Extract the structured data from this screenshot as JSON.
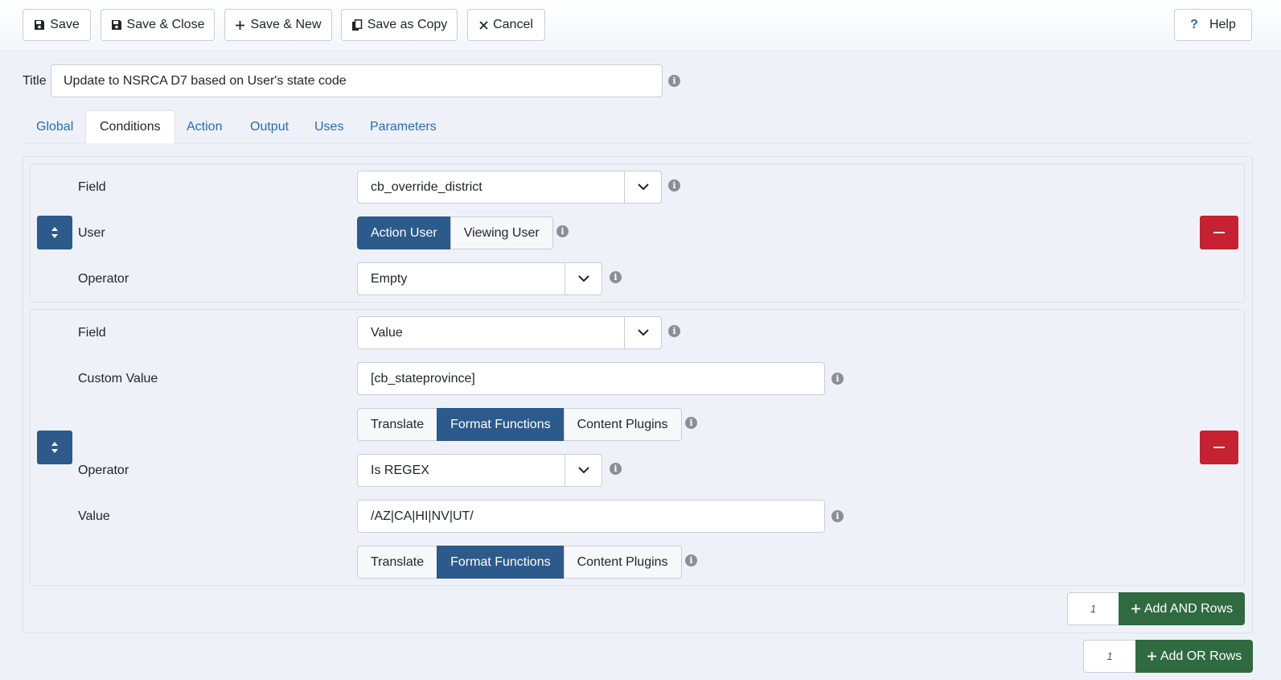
{
  "toolbar": {
    "save": "Save",
    "save_close": "Save & Close",
    "save_new": "Save & New",
    "save_copy": "Save as Copy",
    "cancel": "Cancel",
    "help": "Help"
  },
  "title": {
    "label": "Title",
    "value": "Update to NSRCA D7 based on User's state code"
  },
  "tabs": [
    {
      "label": "Global"
    },
    {
      "label": "Conditions",
      "active": true
    },
    {
      "label": "Action"
    },
    {
      "label": "Output"
    },
    {
      "label": "Uses"
    },
    {
      "label": "Parameters"
    }
  ],
  "conditions": [
    {
      "field_label": "Field",
      "field_value": "cb_override_district",
      "user_label": "User",
      "user_options": [
        "Action User",
        "Viewing User"
      ],
      "user_selected": "Action User",
      "operator_label": "Operator",
      "operator_value": "Empty"
    },
    {
      "field_label": "Field",
      "field_value": "Value",
      "custom_value_label": "Custom Value",
      "custom_value": "[cb_stateprovince]",
      "custom_value_options": [
        "Translate",
        "Format Functions",
        "Content Plugins"
      ],
      "custom_value_selected": "Format Functions",
      "operator_label": "Operator",
      "operator_value": "Is REGEX",
      "value_label": "Value",
      "value": "/AZ|CA|HI|NV|UT/",
      "value_options": [
        "Translate",
        "Format Functions",
        "Content Plugins"
      ],
      "value_selected": "Format Functions"
    }
  ],
  "add_and": {
    "count": "1",
    "label": "Add AND Rows"
  },
  "add_or": {
    "count": "1",
    "label": "Add OR Rows"
  },
  "colors": {
    "primary": "#2c5a8a",
    "danger": "#c52130",
    "success": "#2f6a41",
    "link": "#2a69b8"
  }
}
